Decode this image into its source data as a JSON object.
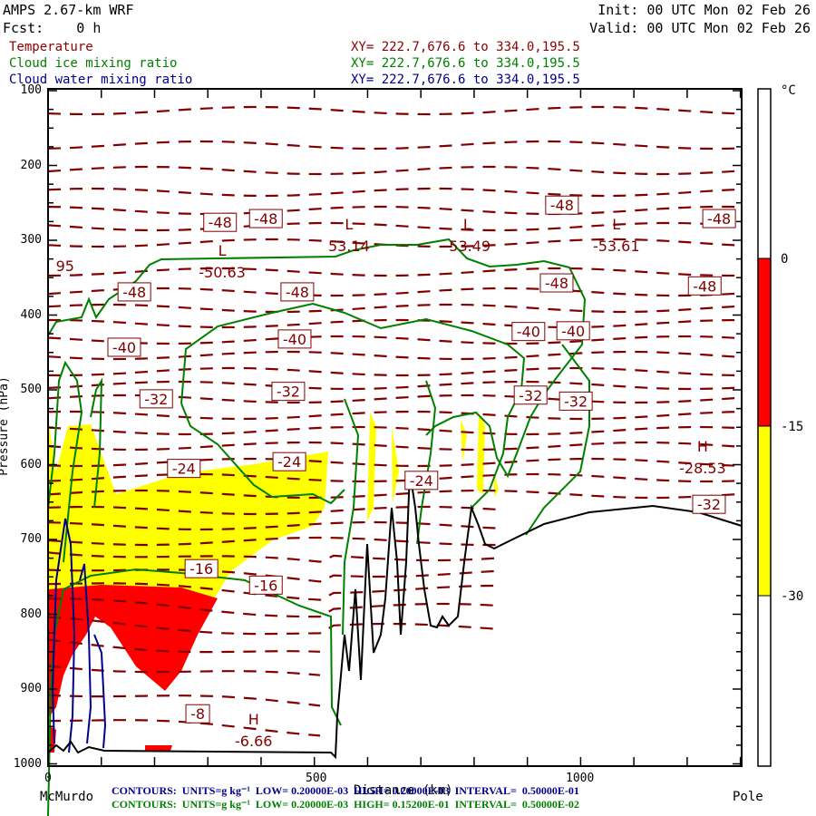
{
  "header": {
    "model": "AMPS 2.67-km WRF",
    "forecast": "Fcst:    0 h",
    "init": "Init: 00 UTC Mon 02 Feb 26",
    "valid": "Valid: 00 UTC Mon 02 Feb 26"
  },
  "fields": [
    {
      "name": "Temperature",
      "xy": "XY= 222.7,676.6 to 334.0,195.5",
      "color": "#8b0000"
    },
    {
      "name": "Cloud ice mixing ratio",
      "xy": "XY= 222.7,676.6 to 334.0,195.5",
      "color": "#008000"
    },
    {
      "name": "Cloud water mixing ratio",
      "xy": "XY= 222.7,676.6 to 334.0,195.5",
      "color": "#00008b"
    }
  ],
  "footer": {
    "start": "McMurdo",
    "end": "Pole",
    "water_contours": "CONTOURS:  UNITS=g kg⁻¹  LOW= 0.20000E-03  HIGH= 0.20000E-03  INTERVAL=  0.50000E-01",
    "ice_contours": "CONTOURS:  UNITS=g kg⁻¹  LOW= 0.20000E-03  HIGH= 0.15200E-01  INTERVAL=  0.50000E-02"
  },
  "chart_data": {
    "type": "contour",
    "xlabel": "Distance (km)",
    "ylabel": "Pressure (hPa)",
    "xlim": [
      0,
      1300
    ],
    "ylim": [
      1000,
      100
    ],
    "xticks": [
      "0",
      "500",
      "1000"
    ],
    "yticks": [
      "100",
      "200",
      "300",
      "400",
      "500",
      "600",
      "700",
      "800",
      "900",
      "1000"
    ],
    "colorbar": {
      "unit": "°C",
      "ticks": [
        "0",
        "-15",
        "-30"
      ],
      "bins": [
        {
          "range": "0 to -15",
          "color": "#ff0000"
        },
        {
          "range": "-15 to -30",
          "color": "#ffff00"
        }
      ]
    },
    "contour_labels": [
      {
        "text": "-48",
        "km": 323,
        "hpa": 276
      },
      {
        "text": "-48",
        "km": 409,
        "hpa": 271
      },
      {
        "text": "-48",
        "km": 162,
        "hpa": 369
      },
      {
        "text": "-48",
        "km": 468,
        "hpa": 369
      },
      {
        "text": "-48",
        "km": 965,
        "hpa": 253
      },
      {
        "text": "-48",
        "km": 1260,
        "hpa": 271
      },
      {
        "text": "-48",
        "km": 955,
        "hpa": 357
      },
      {
        "text": "-48",
        "km": 1233,
        "hpa": 361
      },
      {
        "text": "-40",
        "km": 143,
        "hpa": 443
      },
      {
        "text": "-40",
        "km": 463,
        "hpa": 432
      },
      {
        "text": "-40",
        "km": 902,
        "hpa": 422
      },
      {
        "text": "-40",
        "km": 986,
        "hpa": 421
      },
      {
        "text": "-32",
        "km": 203,
        "hpa": 512
      },
      {
        "text": "-32",
        "km": 451,
        "hpa": 502
      },
      {
        "text": "-32",
        "km": 906,
        "hpa": 507
      },
      {
        "text": "-32",
        "km": 991,
        "hpa": 515
      },
      {
        "text": "-24",
        "km": 255,
        "hpa": 605
      },
      {
        "text": "-24",
        "km": 453,
        "hpa": 596
      },
      {
        "text": "-24",
        "km": 701,
        "hpa": 621
      },
      {
        "text": "-16",
        "km": 288,
        "hpa": 739
      },
      {
        "text": "-16",
        "km": 409,
        "hpa": 761
      },
      {
        "text": "-8",
        "km": 281,
        "hpa": 933
      },
      {
        "text": "-32",
        "km": 1241,
        "hpa": 653
      }
    ],
    "extrema": [
      {
        "type": "L",
        "value": "-50.63",
        "km": 327,
        "hpa": 335
      },
      {
        "type": "L",
        "value": "53.14",
        "km": 565,
        "hpa": 300
      },
      {
        "type": "L",
        "value": "-53.49",
        "km": 787,
        "hpa": 300
      },
      {
        "type": "L",
        "value": "-53.61",
        "km": 1067,
        "hpa": 300
      },
      {
        "type": "H",
        "value": "-28.53",
        "km": 1229,
        "hpa": 597
      },
      {
        "type": "H",
        "value": "-6.66",
        "km": 386,
        "hpa": 962
      }
    ],
    "other_labels": [
      {
        "text": "95",
        "km": 32,
        "hpa": 334
      }
    ]
  }
}
